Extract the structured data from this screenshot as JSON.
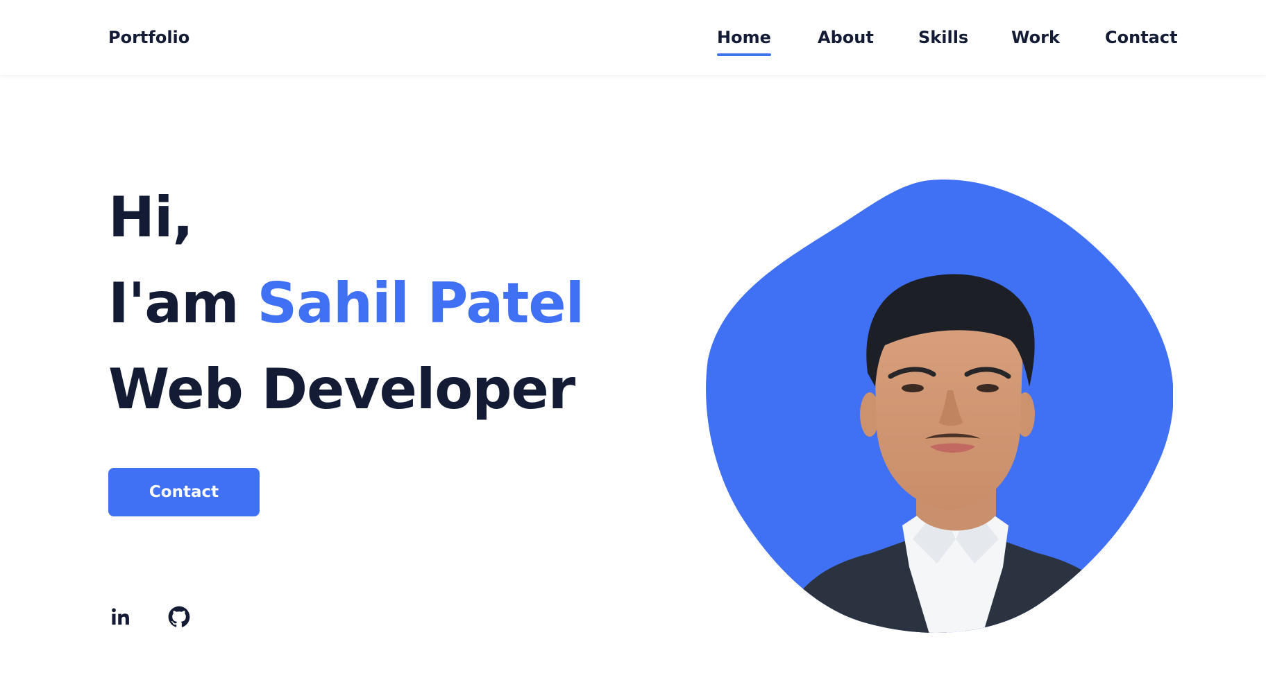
{
  "header": {
    "logo": "Portfolio",
    "nav": [
      {
        "label": "Home",
        "active": true
      },
      {
        "label": "About",
        "active": false
      },
      {
        "label": "Skills",
        "active": false
      },
      {
        "label": "Work",
        "active": false
      },
      {
        "label": "Contact",
        "active": false
      }
    ]
  },
  "hero": {
    "line1": "Hi,",
    "line2_prefix": "I'am ",
    "name": "Sahil Patel",
    "line3": "Web Developer",
    "button_label": "Contact"
  },
  "social": [
    {
      "icon": "linkedin-icon"
    },
    {
      "icon": "github-icon"
    }
  ],
  "colors": {
    "accent": "#4070f4",
    "text": "#131c34",
    "background": "#ffffff"
  }
}
